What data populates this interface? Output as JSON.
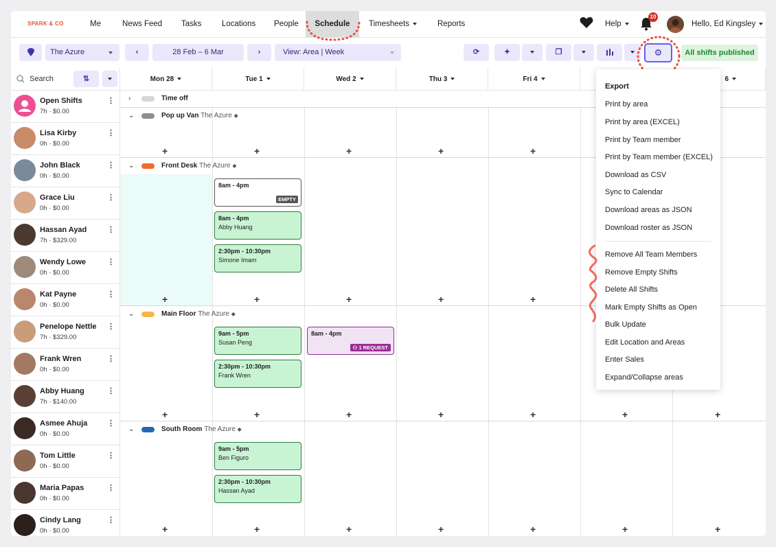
{
  "brand": {
    "logo": "SPARK & CO"
  },
  "nav": {
    "items": [
      "Me",
      "News Feed",
      "Tasks",
      "Locations",
      "People",
      "Schedule",
      "Timesheets",
      "Reports"
    ],
    "help": "Help",
    "notifications": "10",
    "greeting": "Hello, Ed Kingsley"
  },
  "toolbar": {
    "location": "The Azure",
    "date_range": "28 Feb – 6 Mar",
    "view": "View: Area |  Week",
    "published": "All shifts published"
  },
  "sidebar": {
    "search_placeholder": "Search",
    "members": [
      {
        "name": "Open Shifts",
        "sub": "7h · $0.00"
      },
      {
        "name": "Lisa Kirby",
        "sub": "0h · $0.00"
      },
      {
        "name": "John Black",
        "sub": "0h · $0.00"
      },
      {
        "name": "Grace Liu",
        "sub": "0h · $0.00"
      },
      {
        "name": "Hassan Ayad",
        "sub": "7h · $329.00"
      },
      {
        "name": "Wendy Lowe",
        "sub": "0h · $0.00"
      },
      {
        "name": "Kat Payne",
        "sub": "0h · $0.00"
      },
      {
        "name": "Penelope Nettle",
        "sub": "7h · $329.00"
      },
      {
        "name": "Frank Wren",
        "sub": "0h · $0.00"
      },
      {
        "name": "Abby Huang",
        "sub": "7h · $140.00"
      },
      {
        "name": "Asmee Ahuja",
        "sub": "0h · $0.00"
      },
      {
        "name": "Tom Little",
        "sub": "0h · $0.00"
      },
      {
        "name": "Maria Papas",
        "sub": "0h · $0.00"
      },
      {
        "name": "Cindy Lang",
        "sub": "0h · $0.00"
      }
    ]
  },
  "days": [
    "Mon 28",
    "Tue 1",
    "Wed 2",
    "Thu 3",
    "Fri 4",
    "6"
  ],
  "areas": {
    "time_off": {
      "name": "Time off"
    },
    "pop_up_van": {
      "name": "Pop up Van",
      "location": "The Azure"
    },
    "front_desk": {
      "name": "Front Desk",
      "location": "The Azure"
    },
    "main_floor": {
      "name": "Main Floor",
      "location": "The Azure"
    },
    "south_room": {
      "name": "South Room",
      "location": "The Azure"
    }
  },
  "shifts": {
    "fd1": {
      "time": "8am - 4pm",
      "badge": "EMPTY"
    },
    "fd2": {
      "time": "8am - 4pm",
      "name": "Abby Huang"
    },
    "fd3": {
      "time": "2:30pm - 10:30pm",
      "name": "Simone Imam"
    },
    "mf1": {
      "time": "9am - 5pm",
      "name": "Susan Peng"
    },
    "mf2": {
      "time": "2:30pm - 10:30pm",
      "name": "Frank Wren"
    },
    "mf3": {
      "time": "8am - 4pm",
      "badge": "1 REQUEST"
    },
    "sr1": {
      "time": "9am - 5pm",
      "name": "Ben Figuro"
    },
    "sr2": {
      "time": "2:30pm - 10:30pm",
      "name": "Hassan Ayad"
    }
  },
  "menu": {
    "title": "Export",
    "export_items": [
      "Print by area",
      "Print by area (EXCEL)",
      "Print by Team member",
      "Print by Team member (EXCEL)",
      "Download as CSV",
      "Sync to Calendar",
      "Download areas as JSON",
      "Download roster as JSON"
    ],
    "action_items": [
      "Remove All Team Members",
      "Remove Empty Shifts",
      "Delete All Shifts",
      "Mark Empty Shifts as Open",
      "Bulk Update",
      "Edit Location and Areas",
      "Enter Sales",
      "Expand/Collapse areas"
    ]
  },
  "colors": {
    "time_off": "#d6d6d9",
    "pop_up_van": "#8e8e93",
    "front_desk": "#f26a2c",
    "main_floor": "#f5b74a",
    "south_room": "#2268b4",
    "shift_green": "#c9f4d4",
    "accent": "#6b5ce7"
  }
}
